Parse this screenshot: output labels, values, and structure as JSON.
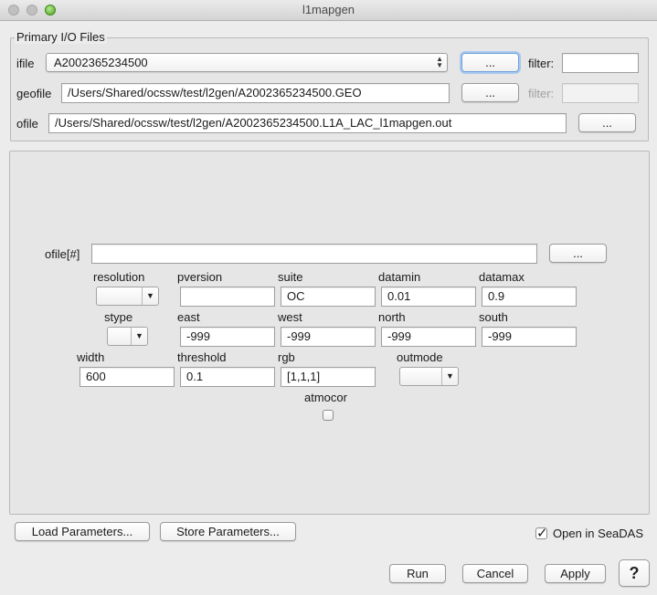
{
  "window": {
    "title": "l1mapgen"
  },
  "primary_io": {
    "legend": "Primary I/O Files",
    "ifile_label": "ifile",
    "ifile_value": "A2002365234500",
    "browse": "...",
    "filter_label": "filter:",
    "filter_value": "",
    "geofile_label": "geofile",
    "geofile_value": "/Users/Shared/ocssw/test/l2gen/A2002365234500.GEO",
    "ofile_label": "ofile",
    "ofile_value": "/Users/Shared/ocssw/test/l2gen/A2002365234500.L1A_LAC_l1mapgen.out"
  },
  "params": {
    "ofile_multi_label": "ofile[#]",
    "ofile_multi_value": "",
    "browse": "...",
    "resolution_label": "resolution",
    "resolution_value": "",
    "pversion_label": "pversion",
    "pversion_value": "",
    "suite_label": "suite",
    "suite_value": "OC",
    "datamin_label": "datamin",
    "datamin_value": "0.01",
    "datamax_label": "datamax",
    "datamax_value": "0.9",
    "stype_label": "stype",
    "stype_value": "",
    "east_label": "east",
    "east_value": "-999",
    "west_label": "west",
    "west_value": "-999",
    "north_label": "north",
    "north_value": "-999",
    "south_label": "south",
    "south_value": "-999",
    "width_label": "width",
    "width_value": "600",
    "threshold_label": "threshold",
    "threshold_value": "0.1",
    "rgb_label": "rgb",
    "rgb_value": "[1,1,1]",
    "outmode_label": "outmode",
    "outmode_value": "",
    "atmocor_label": "atmocor",
    "atmocor_checked": false
  },
  "footer": {
    "load_label": "Load Parameters...",
    "store_label": "Store Parameters...",
    "open_in_seadas_label": "Open in SeaDAS",
    "open_in_seadas_checked": true,
    "run_label": "Run",
    "cancel_label": "Cancel",
    "apply_label": "Apply",
    "help_label": "?"
  }
}
